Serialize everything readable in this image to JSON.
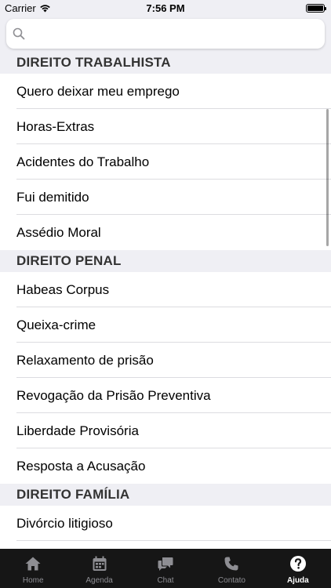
{
  "status_bar": {
    "carrier": "Carrier",
    "time": "7:56 PM"
  },
  "search": {
    "placeholder": "",
    "value": ""
  },
  "sections": [
    {
      "title": "DIREITO TRABALHISTA",
      "items": [
        "Quero deixar meu emprego",
        "Horas-Extras",
        "Acidentes do Trabalho",
        "Fui demitido",
        "Assédio Moral"
      ]
    },
    {
      "title": "DIREITO PENAL",
      "items": [
        "Habeas Corpus",
        "Queixa-crime",
        "Relaxamento de prisão",
        "Revogação da Prisão Preventiva",
        "Liberdade Provisória",
        "Resposta a Acusação"
      ]
    },
    {
      "title": "DIREITO FAMÍLIA",
      "items": [
        "Divórcio litigioso"
      ]
    }
  ],
  "tabs": [
    {
      "label": "Home",
      "icon": "home-icon",
      "active": false
    },
    {
      "label": "Agenda",
      "icon": "calendar-icon",
      "active": false
    },
    {
      "label": "Chat",
      "icon": "chat-icon",
      "active": false
    },
    {
      "label": "Contato",
      "icon": "phone-icon",
      "active": false
    },
    {
      "label": "Ajuda",
      "icon": "help-icon",
      "active": true
    }
  ],
  "colors": {
    "section_background": "#efeff4",
    "tab_bar_background": "#161616",
    "tab_inactive": "#8e8e93",
    "tab_active": "#ffffff"
  }
}
